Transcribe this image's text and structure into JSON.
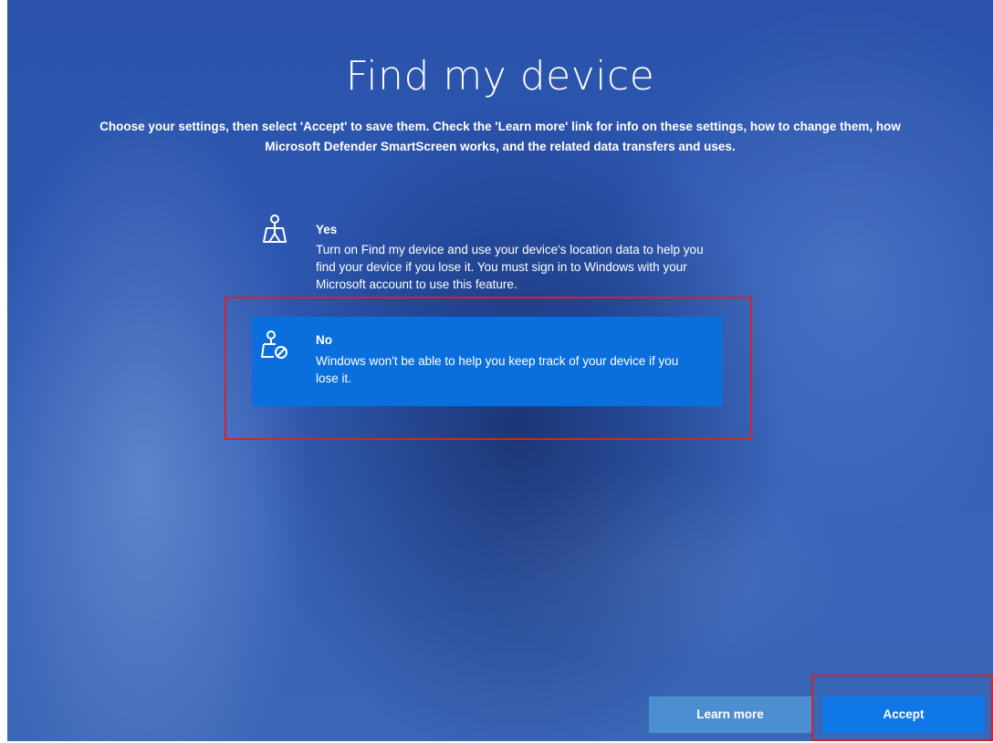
{
  "page": {
    "title": "Find my device",
    "subtitle_line1": "Choose your settings, then select 'Accept' to save them. Check the 'Learn more' link for info on these settings, how to change them, how",
    "subtitle_line2": "Microsoft Defender SmartScreen works, and the related data transfers and uses."
  },
  "options": [
    {
      "label": "Yes",
      "description": "Turn on Find my device and use your device's location data to help you find your device if you lose it. You must sign in to Windows with your Microsoft account to use this feature.",
      "icon": "location-person-icon",
      "selected": false
    },
    {
      "label": "No",
      "description": "Windows won't be able to help you keep track of your device if you lose it.",
      "icon": "location-blocked-icon",
      "selected": true
    }
  ],
  "buttons": {
    "learn_more": "Learn more",
    "accept": "Accept"
  },
  "colors": {
    "background": "#2d58b2",
    "selected_option": "#0a6fdc",
    "accept_button": "#0f78e6",
    "learn_more_button": "#4c8fd0",
    "annotation_border": "#d0242f"
  }
}
